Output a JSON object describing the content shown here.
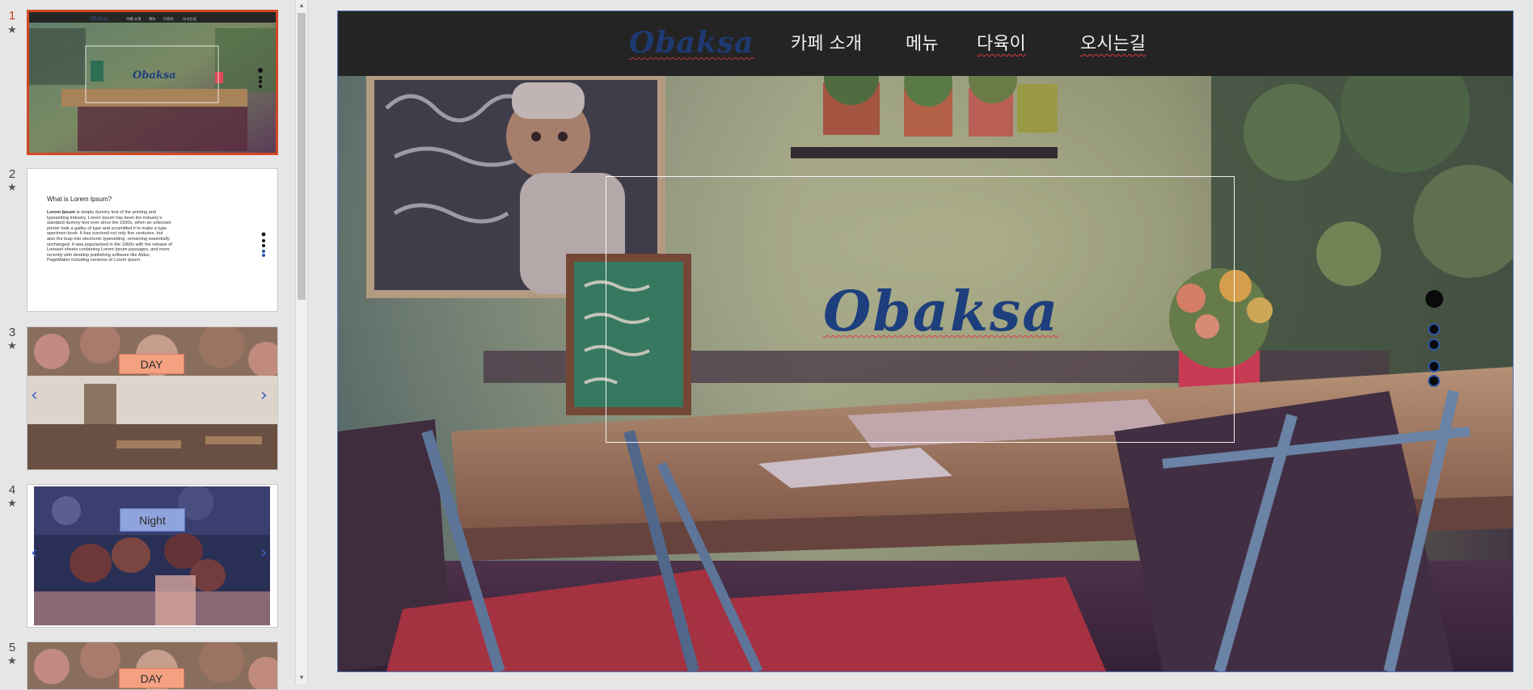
{
  "thumbnails": [
    {
      "number": "1",
      "mark": "★"
    },
    {
      "number": "2",
      "mark": "★",
      "title": "What is Lorem Ipsum?",
      "body_lead": "Lorem Ipsum",
      "body_rest": " is simply dummy text of the printing and typesetting industry. Lorem Ipsum has been the industry's standard dummy text ever since the 1500s, when an unknown printer took a galley of type and scrambled it to make a type specimen book. It has survived not only five centuries, but also the leap into electronic typesetting, remaining essentially unchanged. It was popularised in the 1960s with the release of Letraset sheets containing Lorem Ipsum passages, and more recently with desktop publishing software like Aldus PageMaker including versions of Lorem Ipsum."
    },
    {
      "number": "3",
      "mark": "★",
      "label": "DAY"
    },
    {
      "number": "4",
      "mark": "★",
      "label": "Night"
    },
    {
      "number": "5",
      "mark": "★",
      "label": "DAY"
    }
  ],
  "slide": {
    "nav": {
      "logo": "Obaksa",
      "items": [
        "카페 소개",
        "메뉴",
        "다육이",
        "오시는길"
      ]
    },
    "hero_title": "Obaksa"
  },
  "colors": {
    "accent_active": "#d24726",
    "navbar_bg": "#242424",
    "logo_blue": "#1d3f7d",
    "day_label_bg": "#f4a182",
    "night_label_bg": "#8fa3dc"
  }
}
